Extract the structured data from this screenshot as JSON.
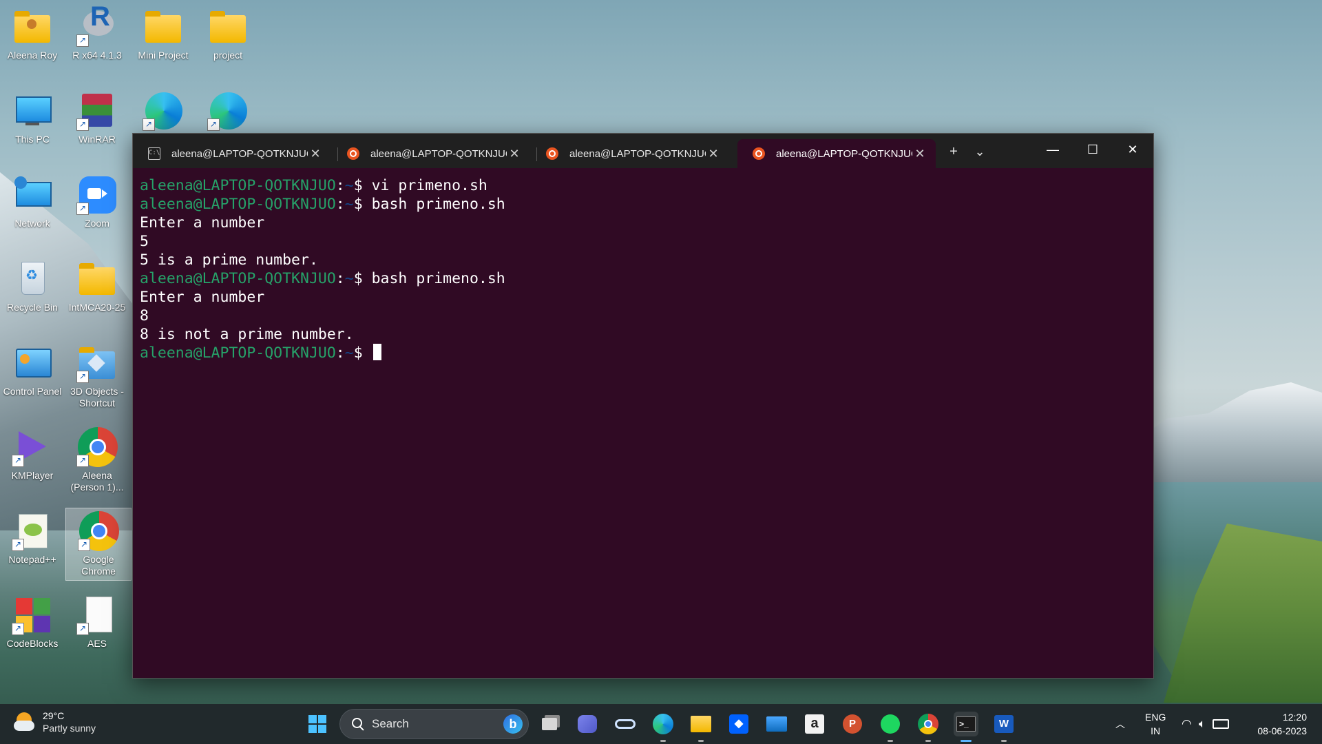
{
  "desktop": {
    "icons": [
      {
        "label": "Aleena Roy"
      },
      {
        "label": "R x64 4.1.3"
      },
      {
        "label": "Mini Project"
      },
      {
        "label": "project"
      },
      {
        "label": "This PC"
      },
      {
        "label": "WinRAR"
      },
      {
        "label": "Network"
      },
      {
        "label": "Zoom"
      },
      {
        "label": "Recycle Bin"
      },
      {
        "label": "IntMCA20-25"
      },
      {
        "label": "Control Panel"
      },
      {
        "label": "3D Objects - Shortcut"
      },
      {
        "label": "KMPlayer"
      },
      {
        "label": "Aleena (Person 1)..."
      },
      {
        "label": "Notepad++"
      },
      {
        "label": "Google Chrome"
      },
      {
        "label": "CodeBlocks"
      },
      {
        "label": "AES"
      }
    ]
  },
  "terminal": {
    "tabs": [
      {
        "label": "aleena@LAPTOP-QOTKNJUO",
        "icon": "cmd-icon"
      },
      {
        "label": "aleena@LAPTOP-QOTKNJUO",
        "icon": "ubuntu-icon"
      },
      {
        "label": "aleena@LAPTOP-QOTKNJUO",
        "icon": "ubuntu-icon"
      },
      {
        "label": "aleena@LAPTOP-QOTKNJUC",
        "icon": "ubuntu-icon"
      }
    ],
    "tab_close": "✕",
    "new_tab": "+",
    "dropdown": "⌄",
    "minimize": "—",
    "maximize": "☐",
    "close": "✕",
    "user_host": "aleena@LAPTOP-QOTKNJUO",
    "path": "~",
    "prompt_sign": "$",
    "lines": [
      {
        "type": "cmd",
        "text": "vi primeno.sh"
      },
      {
        "type": "cmd",
        "text": "bash primeno.sh"
      },
      {
        "type": "out",
        "text": "Enter a number"
      },
      {
        "type": "out",
        "text": "5"
      },
      {
        "type": "out",
        "text": "5 is a prime number."
      },
      {
        "type": "cmd",
        "text": "bash primeno.sh"
      },
      {
        "type": "out",
        "text": "Enter a number"
      },
      {
        "type": "out",
        "text": "8"
      },
      {
        "type": "out",
        "text": "8 is not a prime number."
      },
      {
        "type": "cmd",
        "text": ""
      }
    ],
    "colors": {
      "background": "#300a24",
      "user": "#26a269",
      "path": "#12488b"
    }
  },
  "taskbar": {
    "weather": {
      "temp": "29°C",
      "condition": "Partly sunny"
    },
    "search_placeholder": "Search",
    "apps": [
      "start-icon",
      "search",
      "task-view-icon",
      "teams-icon",
      "glasses-icon",
      "edge-icon",
      "file-explorer-icon",
      "dropbox-icon",
      "mail-icon",
      "amazon-icon",
      "powerpoint-icon",
      "spotify-icon",
      "chrome-icon",
      "terminal-icon",
      "word-icon"
    ],
    "language": {
      "line1": "ENG",
      "line2": "IN"
    },
    "clock": {
      "time": "12:20",
      "date": "08-06-2023"
    }
  }
}
